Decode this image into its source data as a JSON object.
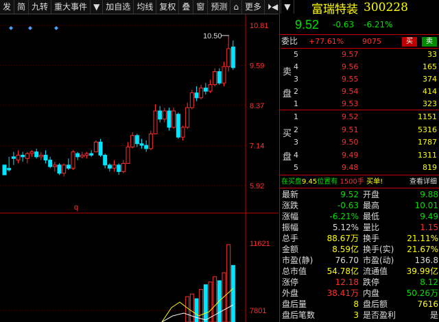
{
  "toolbar": {
    "items": [
      "发",
      "简",
      "九转",
      "重大事件",
      "▼",
      "加自选",
      "均线",
      "复权",
      "叠",
      "窗",
      "预测",
      "⌂",
      "更多",
      "⏵◀",
      "▼"
    ]
  },
  "stock": {
    "name": "富瑞特装",
    "code": "300228",
    "price": "9.52",
    "change": "-0.63",
    "change_pct": "-6.21%"
  },
  "weibi": {
    "label": "委比",
    "ratio": "+77.61%",
    "diff": "9075",
    "buy_btn": "买",
    "sell_btn": "卖"
  },
  "sell_side_label": [
    "卖",
    "盘"
  ],
  "buy_side_label": [
    "买",
    "盘"
  ],
  "sell_orders": [
    {
      "level": "5",
      "price": "9.57",
      "vol": "33"
    },
    {
      "level": "4",
      "price": "9.56",
      "vol": "165"
    },
    {
      "level": "3",
      "price": "9.55",
      "vol": "374"
    },
    {
      "level": "2",
      "price": "9.54",
      "vol": "414"
    },
    {
      "level": "1",
      "price": "9.53",
      "vol": "323"
    }
  ],
  "buy_orders": [
    {
      "level": "1",
      "price": "9.52",
      "vol": "1151"
    },
    {
      "level": "2",
      "price": "9.51",
      "vol": "5316"
    },
    {
      "level": "3",
      "price": "9.50",
      "vol": "1787"
    },
    {
      "level": "4",
      "price": "9.49",
      "vol": "1311"
    },
    {
      "level": "5",
      "price": "9.48",
      "vol": "819"
    }
  ],
  "info_line": {
    "pre": "在买盘",
    "price": "9.45",
    "mid": "位置有",
    "vol": "1500手",
    "post": "买单!",
    "detail": "查看详细"
  },
  "stats": [
    {
      "l1": "最新",
      "v1": "9.52",
      "c1": "grn",
      "l2": "开盘",
      "v2": "9.88",
      "c2": "grn"
    },
    {
      "l1": "涨跌",
      "v1": "-0.63",
      "c1": "grn",
      "l2": "最高",
      "v2": "10.01",
      "c2": "grn"
    },
    {
      "l1": "涨幅",
      "v1": "-6.21%",
      "c1": "grn",
      "l2": "最低",
      "v2": "9.49",
      "c2": "grn"
    },
    {
      "l1": "振幅",
      "v1": "5.12%",
      "c1": "wht",
      "l2": "量比",
      "v2": "1.15",
      "c2": "red"
    },
    {
      "l1": "总手",
      "v1": "88.67万",
      "c1": "yel",
      "l2": "换手",
      "v2": "21.11%",
      "c2": "yel"
    },
    {
      "l1": "金额",
      "v1": "8.59亿",
      "c1": "yel",
      "l2": "换手(实)",
      "v2": "21.67%",
      "c2": "yel"
    },
    {
      "l1": "市盈(静)",
      "v1": "76.70",
      "c1": "wht",
      "l2": "市盈(动)",
      "v2": "136.8",
      "c2": "wht"
    },
    {
      "l1": "总市值",
      "v1": "54.78亿",
      "c1": "yel",
      "l2": "流通值",
      "v2": "39.99亿",
      "c2": "yel"
    },
    {
      "l1": "涨停",
      "v1": "12.18",
      "c1": "red",
      "l2": "跌停",
      "v2": "8.12",
      "c2": "grn"
    },
    {
      "l1": "外盘",
      "v1": "38.41万",
      "c1": "red",
      "l2": "内盘",
      "v2": "50.26万",
      "c2": "grn"
    },
    {
      "l1": "盘后量",
      "v1": "8",
      "c1": "yel",
      "l2": "盘后额",
      "v2": "7616",
      "c2": "yel"
    },
    {
      "l1": "盘后笔数",
      "v1": "3",
      "c1": "yel",
      "l2": "是否盈利",
      "v2": "是",
      "c2": "wht"
    }
  ],
  "chart_data": {
    "type": "candlestick",
    "y_ticks": [
      "10.81",
      "9.59",
      "8.37",
      "7.14",
      "5.92"
    ],
    "y_tick_values": [
      10.81,
      9.59,
      8.37,
      7.14,
      5.92
    ],
    "ylim": [
      5.92,
      10.81
    ],
    "peak_label": "10.50",
    "vol_ticks": [
      "11621",
      "7801"
    ],
    "marker": "q",
    "candles": [
      [
        6.55,
        6.25,
        6.5,
        6.3
      ],
      [
        6.45,
        6.4,
        6.8,
        6.35
      ],
      [
        6.8,
        6.75,
        6.95,
        6.55
      ],
      [
        6.7,
        6.85,
        7.0,
        6.6
      ],
      [
        6.85,
        6.8,
        6.95,
        6.65
      ],
      [
        6.75,
        6.9,
        6.95,
        6.6
      ],
      [
        6.9,
        6.95,
        7.0,
        6.8
      ],
      [
        6.95,
        6.8,
        7.05,
        6.75
      ],
      [
        6.8,
        6.85,
        6.95,
        6.7
      ],
      [
        6.85,
        6.7,
        7.0,
        6.6
      ],
      [
        6.7,
        6.5,
        6.8,
        6.45
      ],
      [
        6.5,
        6.55,
        6.65,
        6.35
      ],
      [
        6.55,
        6.3,
        6.6,
        6.25
      ],
      [
        6.3,
        6.55,
        6.6,
        6.2
      ],
      [
        6.55,
        6.45,
        6.75,
        6.4
      ],
      [
        6.45,
        6.95,
        7.0,
        6.4
      ],
      [
        6.9,
        6.8,
        6.95,
        6.7
      ],
      [
        6.8,
        6.85,
        6.95,
        6.75
      ],
      [
        6.85,
        6.9,
        6.95,
        6.75
      ],
      [
        6.9,
        6.85,
        7.0,
        6.8
      ],
      [
        6.95,
        7.25,
        7.3,
        6.95
      ],
      [
        7.25,
        6.85,
        7.35,
        6.8
      ],
      [
        6.85,
        6.55,
        6.9,
        6.45
      ],
      [
        6.55,
        6.45,
        6.6,
        6.35
      ],
      [
        6.45,
        6.55,
        6.7,
        6.35
      ],
      [
        6.55,
        6.35,
        6.6,
        6.25
      ],
      [
        6.35,
        6.6,
        6.7,
        6.3
      ],
      [
        6.6,
        7.1,
        7.25,
        6.6
      ],
      [
        7.1,
        7.45,
        7.55,
        7.05
      ],
      [
        7.45,
        7.2,
        7.5,
        7.1
      ],
      [
        7.2,
        7.15,
        7.35,
        7.05
      ],
      [
        7.15,
        7.05,
        7.3,
        6.95
      ],
      [
        7.05,
        7.5,
        7.6,
        7.0
      ],
      [
        7.5,
        8.2,
        8.4,
        7.5
      ],
      [
        8.2,
        7.95,
        8.35,
        7.85
      ],
      [
        7.95,
        8.2,
        8.3,
        7.85
      ],
      [
        8.2,
        7.7,
        8.3,
        7.6
      ],
      [
        7.7,
        8.2,
        8.3,
        7.65
      ],
      [
        8.1,
        7.4,
        8.15,
        7.35
      ],
      [
        7.4,
        7.7,
        7.75,
        7.3
      ],
      [
        7.7,
        8.3,
        8.45,
        7.65
      ],
      [
        8.3,
        8.75,
        8.85,
        8.25
      ],
      [
        8.75,
        8.6,
        8.95,
        8.5
      ],
      [
        8.6,
        8.9,
        9.0,
        8.55
      ],
      [
        8.9,
        8.8,
        9.05,
        8.7
      ],
      [
        8.8,
        9.0,
        9.15,
        8.75
      ],
      [
        9.0,
        9.4,
        9.5,
        8.95
      ],
      [
        9.4,
        9.05,
        9.5,
        9.0
      ],
      [
        9.05,
        9.55,
        9.7,
        8.95
      ],
      [
        9.55,
        10.1,
        10.5,
        9.4
      ],
      [
        10.15,
        9.52,
        10.35,
        9.45
      ]
    ],
    "volumes": [
      0,
      0,
      0,
      0,
      0,
      0,
      0,
      0,
      0,
      0,
      0,
      0,
      0,
      0,
      0,
      0,
      0,
      0,
      0,
      0,
      0,
      0,
      0,
      0,
      0,
      0,
      0,
      0,
      0,
      0,
      0,
      0,
      0,
      0,
      0,
      0,
      0,
      0,
      0,
      0,
      3800,
      4200,
      3500,
      4900,
      5600,
      6000,
      6800,
      6200,
      7400,
      11621,
      8500
    ],
    "vol_ylim": [
      0,
      11621
    ]
  }
}
